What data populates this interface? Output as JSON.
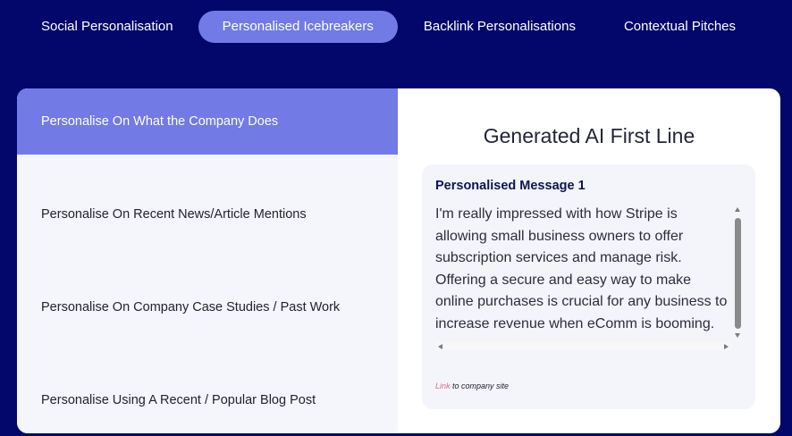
{
  "tabs": [
    {
      "label": "Social Personalisation",
      "active": false
    },
    {
      "label": "Personalised Icebreakers",
      "active": true
    },
    {
      "label": "Backlink Personalisations",
      "active": false
    },
    {
      "label": "Contextual Pitches",
      "active": false
    }
  ],
  "sidebar": {
    "items": [
      {
        "label": "Personalise On What the Company Does",
        "active": true
      },
      {
        "label": "Personalise On Recent News/Article Mentions",
        "active": false
      },
      {
        "label": "Personalise On Company Case Studies / Past Work",
        "active": false
      },
      {
        "label": "Personalise Using A Recent / Popular Blog Post",
        "active": false
      }
    ]
  },
  "main": {
    "title": "Generated AI First Line",
    "card": {
      "title": "Personalised Message 1",
      "message": "I'm really impressed with how Stripe is allowing small business owners to offer subscription services and manage risk. Offering a secure and easy way to make online purchases is crucial for any business to increase revenue when eComm is booming.",
      "link_label": "Link",
      "link_suffix": " to company site"
    }
  },
  "colors": {
    "background": "#03076b",
    "accent": "#727ae6",
    "link": "#e46a8b"
  }
}
